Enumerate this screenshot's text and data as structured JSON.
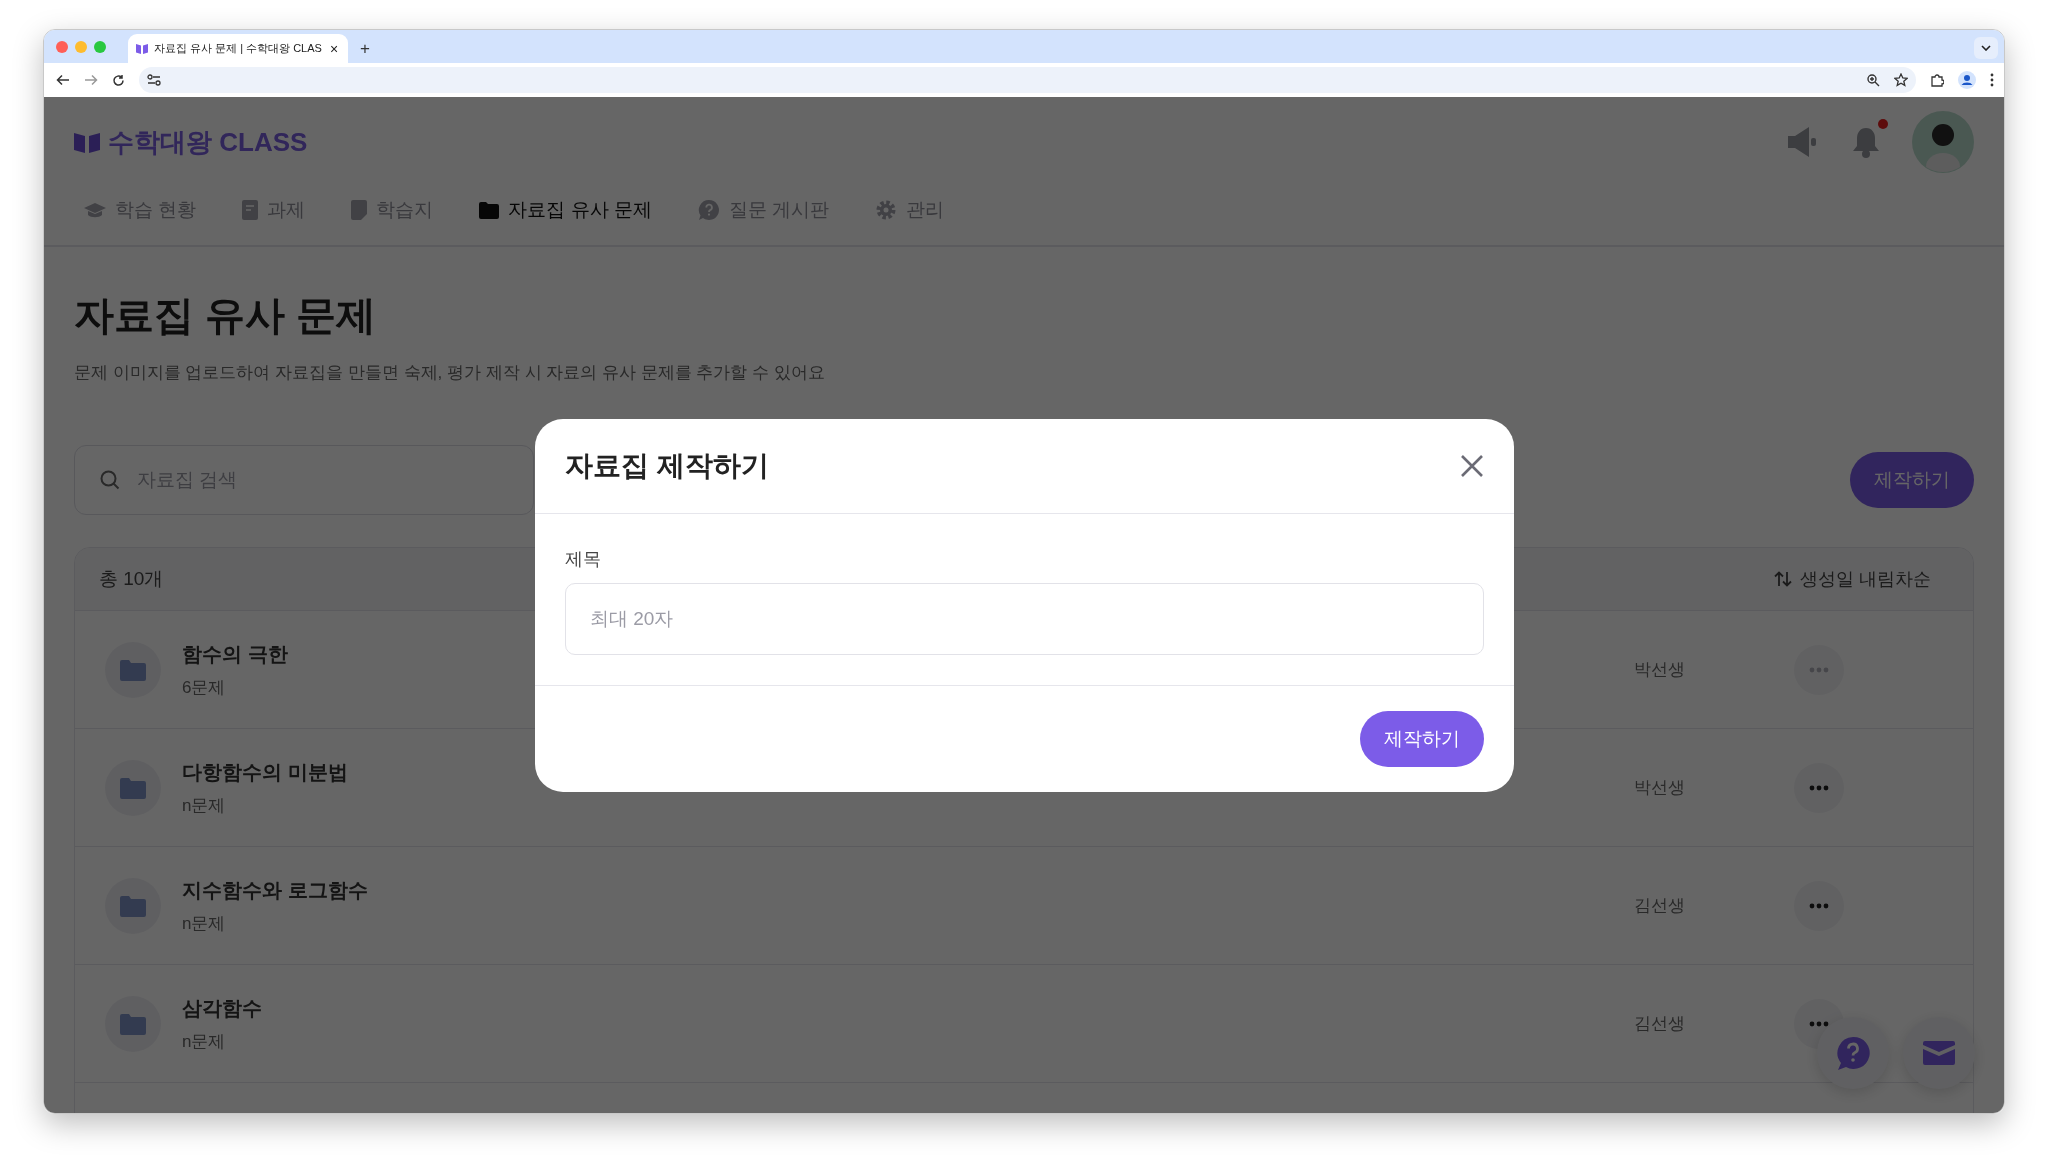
{
  "browser": {
    "tab_title": "자료집 유사 문제 | 수학대왕 CLAS",
    "tab_close": "×",
    "new_tab": "+"
  },
  "header": {
    "logo": "수학대왕 CLASS",
    "has_unread": true
  },
  "nav": [
    {
      "label": "학습 현황",
      "selected": false
    },
    {
      "label": "과제",
      "selected": false
    },
    {
      "label": "학습지",
      "selected": false
    },
    {
      "label": "자료집 유사 문제",
      "selected": true
    },
    {
      "label": "질문 게시판",
      "selected": false
    },
    {
      "label": "관리",
      "selected": false
    }
  ],
  "page": {
    "title": "자료집 유사 문제",
    "subtitle": "문제 이미지를 업로드하여 자료집을 만들면 숙제, 평가 제작 시 자료의 유사 문제를 추가할 수 있어요"
  },
  "search": {
    "placeholder": "자료집 검색"
  },
  "create_button": "제작하기",
  "list": {
    "total": "총 10개",
    "sort": "생성일 내림차순",
    "rows": [
      {
        "title": "함수의 극한",
        "count": "6문제",
        "owner": "박선생",
        "menu_disabled": true
      },
      {
        "title": "다항함수의 미분법",
        "count": "n문제",
        "owner": "박선생",
        "menu_disabled": false
      },
      {
        "title": "지수함수와 로그함수",
        "count": "n문제",
        "owner": "김선생",
        "menu_disabled": false
      },
      {
        "title": "삼각함수",
        "count": "n문제",
        "owner": "김선생",
        "menu_disabled": false
      }
    ]
  },
  "modal": {
    "title": "자료집 제작하기",
    "field_label": "제목",
    "placeholder": "최대 20자",
    "submit": "제작하기"
  }
}
